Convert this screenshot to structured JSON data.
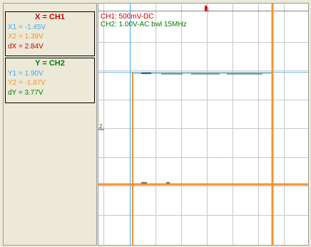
{
  "cursors_x": {
    "title": "X = CH1",
    "x1": "X1 = -1.45V",
    "x2": "X2 = 1.39V",
    "dx": "dX = 2.84V"
  },
  "cursors_y": {
    "title": "Y = CH2",
    "y1": "Y1 = 1.90V",
    "y2": "Y2 = -1.87V",
    "dy": "dY = 3.77V"
  },
  "display": {
    "ch1_info": "CH1: 500mV-DC",
    "ch2_info": "CH2: 1.00V-AC bwl 15MHz",
    "trigger_marker": "1",
    "ground_marker": "2"
  },
  "colors": {
    "ch1": "#d00000",
    "ch2": "#008000",
    "cursor_x1": "#3fa9f5",
    "cursor_x2_trace": "#f5932b",
    "background": "#ece9d8",
    "plot": "#ffffff",
    "grid": "#c8c8c8"
  }
}
